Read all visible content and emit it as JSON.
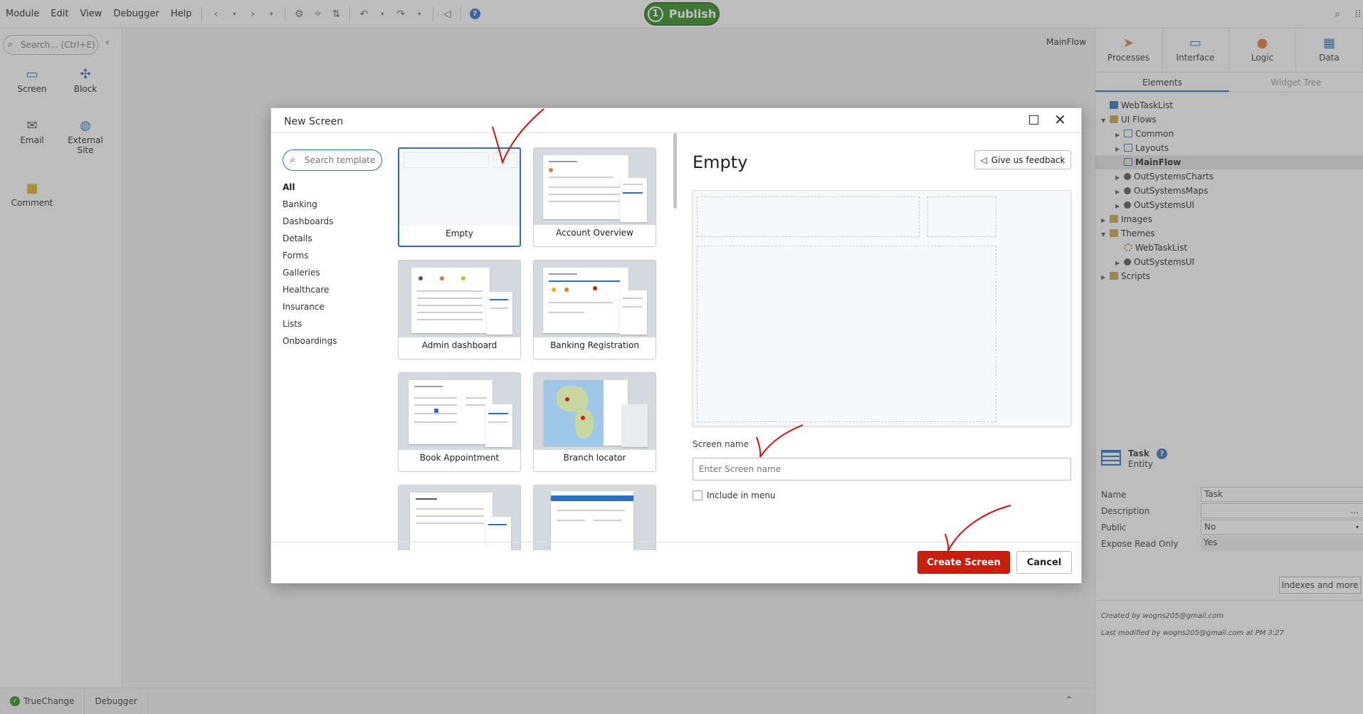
{
  "menubar": {
    "items": [
      "Module",
      "Edit",
      "View",
      "Debugger",
      "Help"
    ],
    "publish_label": "Publish",
    "publish_count": "1"
  },
  "left_panel": {
    "search_placeholder": "Search... (Ctrl+E)",
    "tools": [
      {
        "label": "Screen",
        "icon": "screen-icon"
      },
      {
        "label": "Block",
        "icon": "block-icon"
      },
      {
        "label": "Email",
        "icon": "email-icon"
      },
      {
        "label": "External Site",
        "icon": "globe-icon"
      },
      {
        "label": "Comment",
        "icon": "comment-icon"
      }
    ]
  },
  "canvas": {
    "flow_name": "MainFlow"
  },
  "right_panel": {
    "tabs": [
      "Processes",
      "Interface",
      "Logic",
      "Data"
    ],
    "active_tab": "Interface",
    "subtabs": [
      "Elements",
      "Widget Tree"
    ],
    "active_subtab": "Elements",
    "tree": [
      {
        "label": "WebTaskList",
        "depth": 0,
        "arrow": "",
        "icon": "module-icon"
      },
      {
        "label": "UI Flows",
        "depth": 0,
        "arrow": "▼",
        "icon": "folder-icon"
      },
      {
        "label": "Common",
        "depth": 1,
        "arrow": "▶",
        "icon": "flow-icon"
      },
      {
        "label": "Layouts",
        "depth": 1,
        "arrow": "▶",
        "icon": "flow-icon"
      },
      {
        "label": "MainFlow",
        "depth": 1,
        "arrow": "",
        "icon": "flow-icon",
        "selected": true
      },
      {
        "label": "OutSystemsCharts",
        "depth": 1,
        "arrow": "▶",
        "icon": "dependency-icon"
      },
      {
        "label": "OutSystemsMaps",
        "depth": 1,
        "arrow": "▶",
        "icon": "dependency-icon"
      },
      {
        "label": "OutSystemsUI",
        "depth": 1,
        "arrow": "▶",
        "icon": "dependency-icon"
      },
      {
        "label": "Images",
        "depth": 0,
        "arrow": "▶",
        "icon": "folder-icon"
      },
      {
        "label": "Themes",
        "depth": 0,
        "arrow": "▼",
        "icon": "folder-icon"
      },
      {
        "label": "WebTaskList",
        "depth": 1,
        "arrow": "",
        "icon": "theme-icon"
      },
      {
        "label": "OutSystemsUI",
        "depth": 1,
        "arrow": "▶",
        "icon": "dependency-icon"
      },
      {
        "label": "Scripts",
        "depth": 0,
        "arrow": "▶",
        "icon": "folder-icon"
      }
    ],
    "entity": {
      "title": "Task",
      "subtitle": "Entity",
      "props": [
        {
          "label": "Name",
          "value": "Task"
        },
        {
          "label": "Description",
          "value": "..."
        },
        {
          "label": "Public",
          "value": "No"
        },
        {
          "label": "Expose Read Only",
          "value": "Yes"
        }
      ],
      "indexes_button": "Indexes and more",
      "created_by": "Created by wogns205@gmail.com",
      "modified_by": "Last modified by wogns205@gmail.com at PM 3:27"
    }
  },
  "bottom_bar": {
    "tabs": [
      "TrueChange",
      "Debugger"
    ]
  },
  "modal": {
    "title": "New Screen",
    "search_placeholder": "Search template",
    "categories": [
      "All",
      "Banking",
      "Dashboards",
      "Details",
      "Forms",
      "Galleries",
      "Healthcare",
      "Insurance",
      "Lists",
      "Onboardings"
    ],
    "active_category": "All",
    "templates": [
      "Empty",
      "Account Overview",
      "Admin dashboard",
      "Banking Registration",
      "Book Appointment",
      "Branch locator",
      "",
      ""
    ],
    "selected_template": "Empty",
    "preview_title": "Empty",
    "feedback_label": "Give us feedback",
    "screen_name_label": "Screen name",
    "screen_name_placeholder": "Enter Screen name",
    "include_menu_label": "Include in menu",
    "create_label": "Create Screen",
    "cancel_label": "Cancel"
  },
  "colors": {
    "accent": "#2d6fc4",
    "publish_green": "#2e8a1e",
    "create_red": "#c8200e",
    "annotation_red": "#d01010"
  }
}
